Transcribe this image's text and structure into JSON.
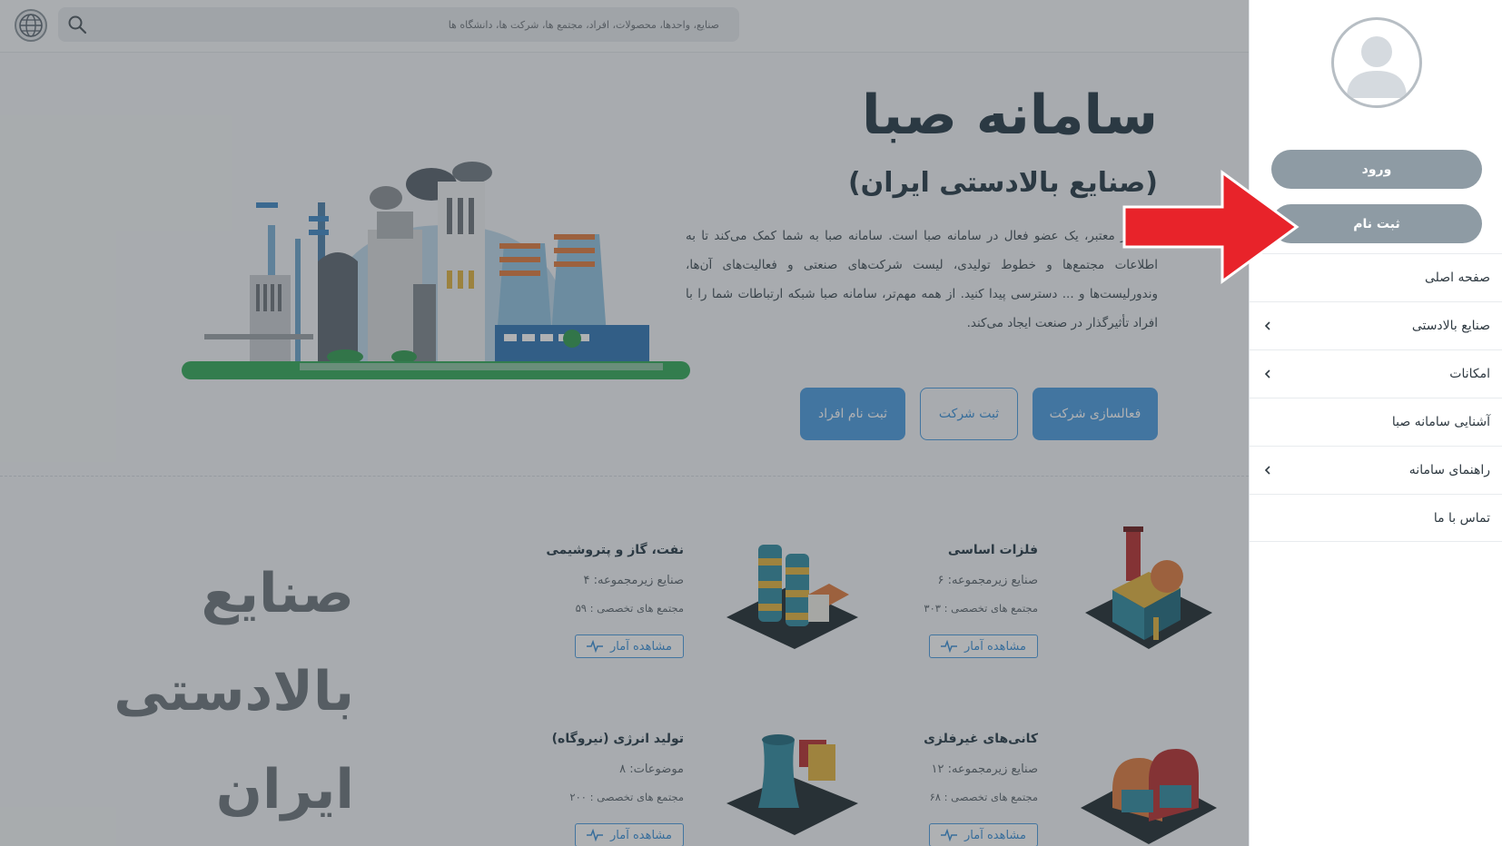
{
  "search": {
    "placeholder": "صنایع، واحدها، محصولات، افراد، مجتمع ها، شرکت ها، دانشگاه ها"
  },
  "hero": {
    "title": "سامانه صبا",
    "subtitle": "(صنایع بالادستی ایران)",
    "text": "صنعتگر معتبر، یک عضو فعال در سامانه صبا است. سامانه صبا به شما کمک می‌کند تا به اطلاعات مجتمع‌ها و خطوط تولیدی، لیست شرکت‌های صنعتی و فعالیت‌های آن‌ها، وندورلیست‌ها و ... دسترسی پیدا کنید. از همه مهم‌تر، سامانه صبا شبکه ارتباطات شما را با افراد تأثیرگذار در صنعت ایجاد می‌کند.",
    "buttons": {
      "register_person": "ثبت نام افراد",
      "register_company": "ثبت شرکت",
      "activate_company": "فعالسازی شرکت"
    }
  },
  "section": {
    "heading": "صنایع بالادستی ایران"
  },
  "cards": [
    {
      "name": "فلزات اساسی",
      "line1": "صنایع زیرمجموعه: ۶",
      "line2": "مجتمع های تخصصی : ۳۰۳",
      "stat": "مشاهده آمار"
    },
    {
      "name": "نفت، گاز و پتروشیمی",
      "line1": "صنایع زیرمجموعه: ۴",
      "line2": "مجتمع های تخصصی : ۵۹",
      "stat": "مشاهده آمار"
    },
    {
      "name": "کانی‌های غیرفلزی",
      "line1": "صنایع زیرمجموعه: ۱۲",
      "line2": "مجتمع های تخصصی : ۶۸",
      "stat": "مشاهده آمار"
    },
    {
      "name": "تولید انرژی (نیروگاه)",
      "line1": "موضوعات: ۸",
      "line2": "مجتمع های تخصصی : ۲۰۰",
      "stat": "مشاهده آمار"
    }
  ],
  "drawer": {
    "login": "ورود",
    "signup": "ثبت نام",
    "menu": [
      {
        "label": "صفحه اصلی",
        "expandable": false
      },
      {
        "label": "صنایع بالادستی",
        "expandable": true
      },
      {
        "label": "امکانات",
        "expandable": true
      },
      {
        "label": "آشنایی سامانه صبا",
        "expandable": false
      },
      {
        "label": "راهنمای سامانه",
        "expandable": true
      },
      {
        "label": "تماس با ما",
        "expandable": false
      }
    ]
  },
  "colors": {
    "primary": "#4a9be0",
    "drawer_button": "#8e9ba4",
    "annotation_arrow": "#e8232a",
    "overlay": "rgba(55,60,64,0.40)"
  },
  "icons": [
    "globe-logo-icon",
    "search-icon",
    "user-avatar-icon",
    "chevron-left-icon",
    "pulse-icon",
    "red-arrow"
  ]
}
